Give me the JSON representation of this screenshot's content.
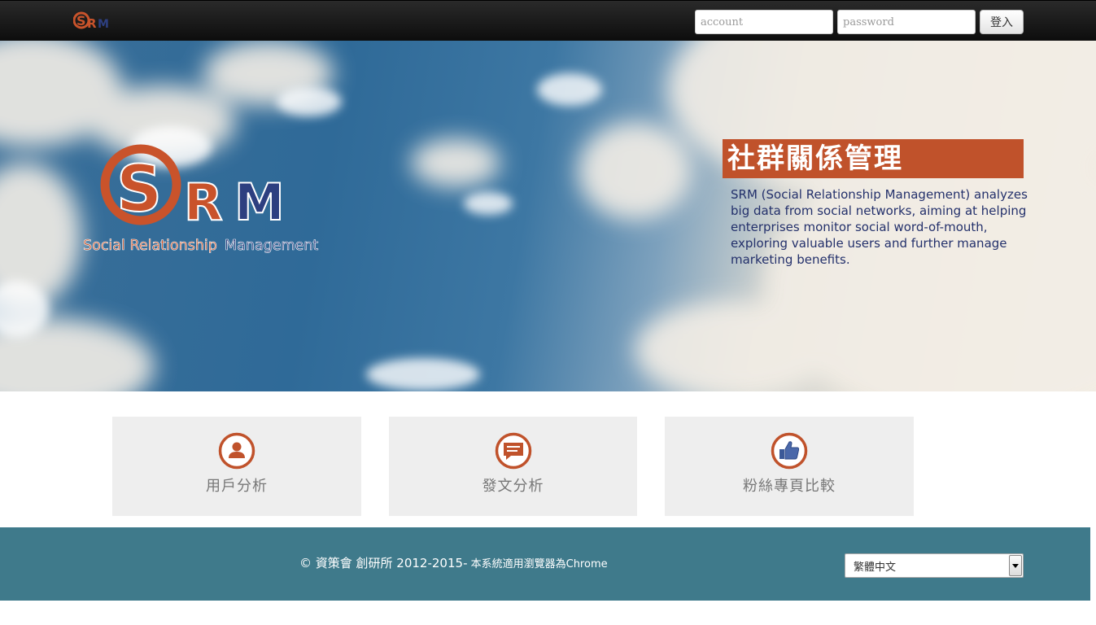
{
  "header": {
    "logo_text": "SRM",
    "account_placeholder": "account",
    "password_placeholder": "password",
    "login_label": "登入"
  },
  "hero": {
    "logo_letters": "SRM",
    "logo_subtitle": "Social Relationship Management",
    "title": "社群關係管理",
    "description": "SRM (Social Relationship Management) analyzes big data from social networks, aiming at helping enterprises monitor social word-of-mouth, exploring valuable users and further manage marketing benefits."
  },
  "cards": [
    {
      "label": "用戶分析",
      "icon": "user-icon"
    },
    {
      "label": "發文分析",
      "icon": "speech-bubble-icon"
    },
    {
      "label": "粉絲專頁比較",
      "icon": "thumbs-up-icon"
    }
  ],
  "footer": {
    "copyright_main": "© 資策會 創研所 2012-2015-",
    "copyright_note": " 本系統適用瀏覽器為Chrome",
    "language_selected": "繁體中文"
  },
  "colors": {
    "accent": "#c0522b",
    "navy": "#23306b",
    "footer_bg": "#3f7a8b",
    "card_bg": "#eeeeee",
    "topbar_bg": "#111111"
  }
}
